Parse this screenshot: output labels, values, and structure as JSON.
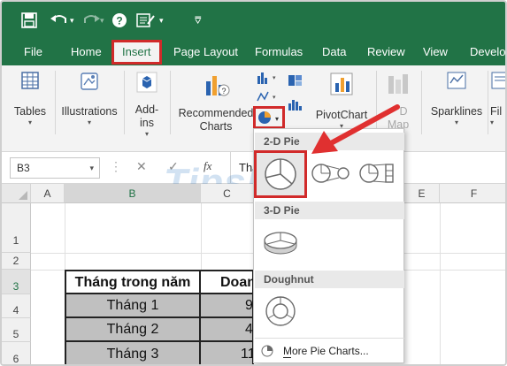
{
  "quick_access": {
    "save_icon": "save-icon",
    "undo_icon": "undo-icon",
    "redo_icon": "redo-icon",
    "help_icon": "help-icon",
    "form_icon": "form-icon",
    "customize_icon": "customize-icon"
  },
  "tabs": [
    {
      "label": "File"
    },
    {
      "label": "Home"
    },
    {
      "label": "Insert"
    },
    {
      "label": "Page Layout"
    },
    {
      "label": "Formulas"
    },
    {
      "label": "Data"
    },
    {
      "label": "Review"
    },
    {
      "label": "View"
    },
    {
      "label": "Develop"
    }
  ],
  "ribbon": {
    "tables": "Tables",
    "illustrations": "Illustrations",
    "addins_line1": "Add-",
    "addins_line2": "ins",
    "recommended_line1": "Recommended",
    "recommended_line2": "Charts",
    "group_partial": "C",
    "pivotchart": "PivotChart",
    "map_line1": "D",
    "map_line2": "Map",
    "sparklines": "Sparklines",
    "filters": "Fil"
  },
  "formula_bar": {
    "name_box": "B3",
    "cancel": "✕",
    "enter": "✓",
    "fx": "fx",
    "content": "Thá"
  },
  "columns": [
    "A",
    "B",
    "C",
    "D",
    "E",
    "F"
  ],
  "rows": [
    "1",
    "2",
    "3",
    "4",
    "5",
    "6"
  ],
  "table": {
    "header_b": "Tháng trong năm",
    "header_c": "Doan",
    "rows": [
      {
        "b": "Tháng 1",
        "c": "9"
      },
      {
        "b": "Tháng 2",
        "c": "4"
      },
      {
        "b": "Tháng 3",
        "c": "11"
      }
    ]
  },
  "pie_menu": {
    "section_2d": "2-D Pie",
    "section_3d": "3-D Pie",
    "section_doughnut": "Doughnut",
    "more": "More Pie Charts...",
    "more_underline_letter": "M"
  },
  "watermark": "TipsMake",
  "colors": {
    "excel_green": "#217346",
    "highlight_red": "#d12a2a",
    "header_row_fill": "#ffffff",
    "data_row_fill": "#c0c0c0"
  }
}
